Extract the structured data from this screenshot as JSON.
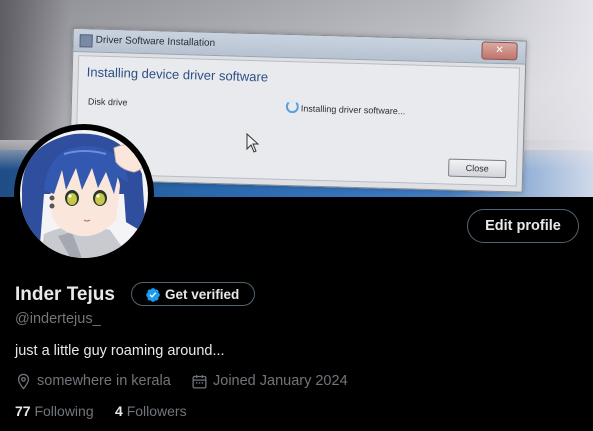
{
  "banner": {
    "dialog_title": "Driver Software Installation",
    "dialog_heading": "Installing device driver software",
    "device_name": "Disk drive",
    "device_status": "Installing driver software...",
    "dialog_close_button": "Close",
    "dialog_close_x": "✕"
  },
  "profile": {
    "edit_profile_label": "Edit profile",
    "display_name": "Inder Tejus",
    "get_verified_label": "Get verified",
    "handle": "@indertejus_",
    "bio": "just a little guy roaming around...",
    "location": "somewhere in kerala",
    "joined": "Joined January 2024",
    "following_count": "77",
    "following_label": "Following",
    "followers_count": "4",
    "followers_label": "Followers"
  },
  "colors": {
    "background": "#000000",
    "primary_text": "#e7e9ea",
    "secondary_text": "#71767b",
    "border": "#536471",
    "verified_blue": "#1d9bf0"
  },
  "icons": {
    "verified": "verified-badge-icon",
    "location": "location-pin-icon",
    "calendar": "calendar-icon"
  }
}
